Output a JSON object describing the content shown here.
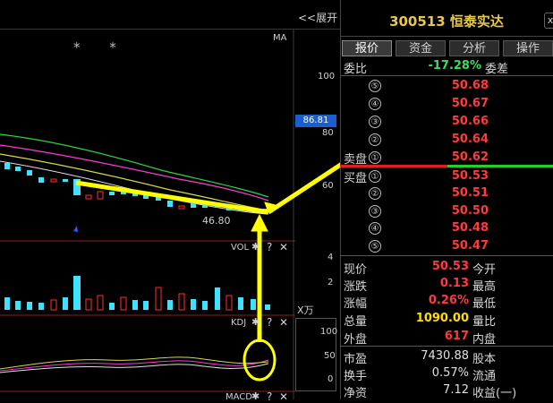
{
  "chart": {
    "expand_label": "<<展开",
    "ma_label": "MA",
    "stars": "* *",
    "y_ticks": [
      "100",
      "80",
      "60"
    ],
    "current_price_tag": "86.81",
    "min_price_label": "46.80",
    "vol": {
      "label": "VOL",
      "ticks": [
        "4",
        "2"
      ],
      "unit": "X万"
    },
    "kdj": {
      "label": "KDJ",
      "ticks": [
        "100",
        "50",
        "0"
      ]
    },
    "macd": {
      "label": "MACD"
    },
    "colors": {
      "candle_up": "#ff3030",
      "candle_down": "#40e0ff",
      "annotation": "#ffff00"
    }
  },
  "panel": {
    "title": "300513 恒泰实达",
    "tabs": [
      "报价",
      "资金",
      "分析",
      "操作"
    ],
    "weibi": {
      "label": "委比",
      "value": "-17.28%",
      "label2": "委差"
    },
    "sell": [
      {
        "n": "⑤",
        "price": "50.68"
      },
      {
        "n": "④",
        "price": "50.67"
      },
      {
        "n": "③",
        "price": "50.66"
      },
      {
        "n": "②",
        "price": "50.64"
      },
      {
        "n": "①",
        "price": "50.62",
        "label": "卖盘"
      }
    ],
    "buy": [
      {
        "n": "①",
        "price": "50.53",
        "label": "买盘"
      },
      {
        "n": "②",
        "price": "50.51"
      },
      {
        "n": "③",
        "price": "50.50"
      },
      {
        "n": "④",
        "price": "50.48"
      },
      {
        "n": "⑤",
        "price": "50.47"
      }
    ],
    "stats": [
      {
        "l": "现价",
        "v": "50.53",
        "r": "今开",
        "c": "red"
      },
      {
        "l": "涨跌",
        "v": "0.13",
        "r": "最高",
        "c": "red"
      },
      {
        "l": "涨幅",
        "v": "0.26%",
        "r": "最低",
        "c": "red"
      },
      {
        "l": "总量",
        "v": "1090.00",
        "r": "量比",
        "c": "yellow"
      },
      {
        "l": "外盘",
        "v": "617",
        "r": "内盘",
        "c": "red"
      },
      {
        "l": "市盈",
        "v": "7430.88",
        "r": "股本",
        "c": "white"
      },
      {
        "l": "换手",
        "v": "0.57%",
        "r": "流通",
        "c": "white"
      },
      {
        "l": "净资",
        "v": "7.12",
        "r": "收益(一)",
        "c": "white"
      }
    ]
  }
}
